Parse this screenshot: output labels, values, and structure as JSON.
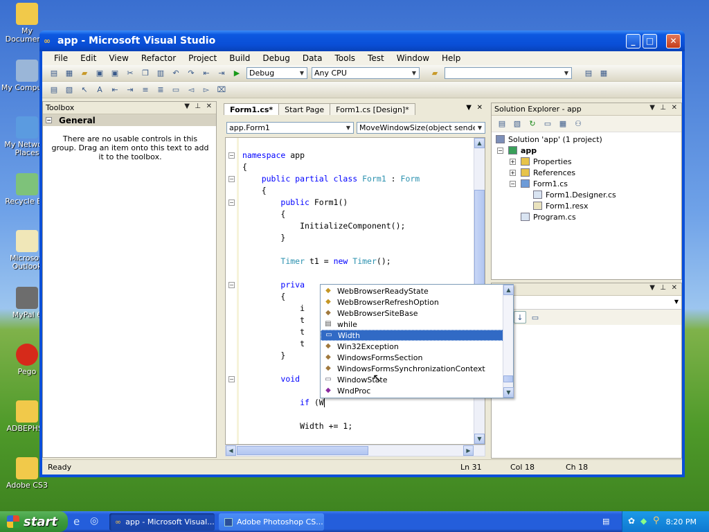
{
  "desktop": {
    "icons": [
      {
        "label": "My Documents",
        "icon": "folder-icon"
      },
      {
        "label": "My Computer",
        "icon": "computer-icon"
      },
      {
        "label": "My Network Places",
        "icon": "network-icon"
      },
      {
        "label": "Recycle Bin",
        "icon": "recycle-bin-icon"
      },
      {
        "label": "Microsoft Outlook",
        "icon": "outlook-icon"
      },
      {
        "label": "MyPal 6",
        "icon": "raccoon-icon"
      },
      {
        "label": "Pego",
        "icon": "red-ball-icon"
      },
      {
        "label": "ADBEPHSP",
        "icon": "folder-icon"
      },
      {
        "label": "Adobe CS3",
        "icon": "folder-icon"
      }
    ]
  },
  "window": {
    "title": "app - Microsoft Visual Studio"
  },
  "menu": [
    "File",
    "Edit",
    "View",
    "Refactor",
    "Project",
    "Build",
    "Debug",
    "Data",
    "Tools",
    "Test",
    "Window",
    "Help"
  ],
  "toolbar": {
    "config": "Debug",
    "platform": "Any CPU"
  },
  "toolbox": {
    "title": "Toolbox",
    "group": "General",
    "empty_text": "There are no usable controls in this group. Drag an item onto this text to add it to the toolbox."
  },
  "editor": {
    "tabs": [
      "Form1.cs*",
      "Start Page",
      "Form1.cs [Design]*"
    ],
    "class_combo": "app.Form1",
    "member_combo": "MoveWindowSize(object sende",
    "lines": [
      {
        "indent": 0,
        "parts": [
          [
            "kw",
            "namespace"
          ],
          [
            "t",
            " app"
          ]
        ]
      },
      {
        "indent": 0,
        "parts": [
          [
            "t",
            "{"
          ]
        ]
      },
      {
        "indent": 1,
        "parts": [
          [
            "kw",
            "public partial class"
          ],
          [
            "t",
            " "
          ],
          [
            "ty",
            "Form1"
          ],
          [
            "t",
            " : "
          ],
          [
            "ty",
            "Form"
          ]
        ]
      },
      {
        "indent": 1,
        "parts": [
          [
            "t",
            "{"
          ]
        ]
      },
      {
        "indent": 2,
        "parts": [
          [
            "kw",
            "public"
          ],
          [
            "t",
            " Form1()"
          ]
        ]
      },
      {
        "indent": 2,
        "parts": [
          [
            "t",
            "{"
          ]
        ]
      },
      {
        "indent": 3,
        "parts": [
          [
            "t",
            "InitializeComponent();"
          ]
        ]
      },
      {
        "indent": 2,
        "parts": [
          [
            "t",
            "}"
          ]
        ]
      },
      {
        "indent": 0,
        "parts": [
          [
            "t",
            ""
          ]
        ]
      },
      {
        "indent": 2,
        "parts": [
          [
            "ty",
            "Timer"
          ],
          [
            "t",
            " t1 = "
          ],
          [
            "kw",
            "new"
          ],
          [
            "t",
            " "
          ],
          [
            "ty",
            "Timer"
          ],
          [
            "t",
            "();"
          ]
        ]
      },
      {
        "indent": 0,
        "parts": [
          [
            "t",
            ""
          ]
        ]
      },
      {
        "indent": 2,
        "parts": [
          [
            "kw",
            "priva"
          ]
        ]
      },
      {
        "indent": 2,
        "parts": [
          [
            "t",
            "{"
          ]
        ]
      },
      {
        "indent": 3,
        "parts": [
          [
            "t",
            "i"
          ]
        ]
      },
      {
        "indent": 3,
        "parts": [
          [
            "t",
            "t"
          ]
        ]
      },
      {
        "indent": 3,
        "parts": [
          [
            "t",
            "t"
          ]
        ]
      },
      {
        "indent": 3,
        "parts": [
          [
            "t",
            "t"
          ]
        ]
      },
      {
        "indent": 2,
        "parts": [
          [
            "t",
            "}"
          ]
        ]
      },
      {
        "indent": 0,
        "parts": [
          [
            "t",
            ""
          ]
        ]
      },
      {
        "indent": 2,
        "parts": [
          [
            "kw",
            "void"
          ]
        ]
      },
      {
        "indent": 0,
        "parts": [
          [
            "t",
            ""
          ]
        ]
      },
      {
        "indent": 3,
        "parts": [
          [
            "kw",
            "if"
          ],
          [
            "t",
            " (W"
          ]
        ]
      },
      {
        "indent": 0,
        "parts": [
          [
            "t",
            ""
          ]
        ]
      },
      {
        "indent": 3,
        "parts": [
          [
            "t",
            "Width += 1;"
          ]
        ]
      }
    ]
  },
  "intellisense": {
    "items": [
      {
        "label": "WebBrowserReadyState",
        "icon": "enum-icon"
      },
      {
        "label": "WebBrowserRefreshOption",
        "icon": "enum-icon"
      },
      {
        "label": "WebBrowserSiteBase",
        "icon": "class-icon"
      },
      {
        "label": "while",
        "icon": "keyword-icon"
      },
      {
        "label": "Width",
        "icon": "property-icon"
      },
      {
        "label": "Win32Exception",
        "icon": "class-icon"
      },
      {
        "label": "WindowsFormsSection",
        "icon": "class-icon"
      },
      {
        "label": "WindowsFormsSynchronizationContext",
        "icon": "class-icon"
      },
      {
        "label": "WindowState",
        "icon": "property-icon"
      },
      {
        "label": "WndProc",
        "icon": "method-icon"
      }
    ],
    "selected": 4
  },
  "solution_explorer": {
    "title": "Solution Explorer - app",
    "nodes": [
      {
        "label": "Solution 'app' (1 project)",
        "depth": 0,
        "icon": "solution-icon",
        "bold": false
      },
      {
        "label": "app",
        "depth": 1,
        "icon": "project-icon",
        "bold": true
      },
      {
        "label": "Properties",
        "depth": 2,
        "icon": "properties-folder-icon",
        "bold": false
      },
      {
        "label": "References",
        "depth": 2,
        "icon": "references-folder-icon",
        "bold": false
      },
      {
        "label": "Form1.cs",
        "depth": 2,
        "icon": "form-icon",
        "bold": false
      },
      {
        "label": "Form1.Designer.cs",
        "depth": 3,
        "icon": "cs-file-icon",
        "bold": false
      },
      {
        "label": "Form1.resx",
        "depth": 3,
        "icon": "resx-file-icon",
        "bold": false
      },
      {
        "label": "Program.cs",
        "depth": 2,
        "icon": "cs-file-icon",
        "bold": false
      }
    ]
  },
  "properties_pane": {
    "title_visible": "rties"
  },
  "status": {
    "text": "Ready",
    "ln": "Ln 31",
    "col": "Col 18",
    "ch": "Ch 18"
  },
  "taskbar": {
    "start": "start",
    "tasks": [
      "app - Microsoft Visual...",
      "Adobe Photoshop CS..."
    ],
    "clock": "8:20 PM"
  }
}
